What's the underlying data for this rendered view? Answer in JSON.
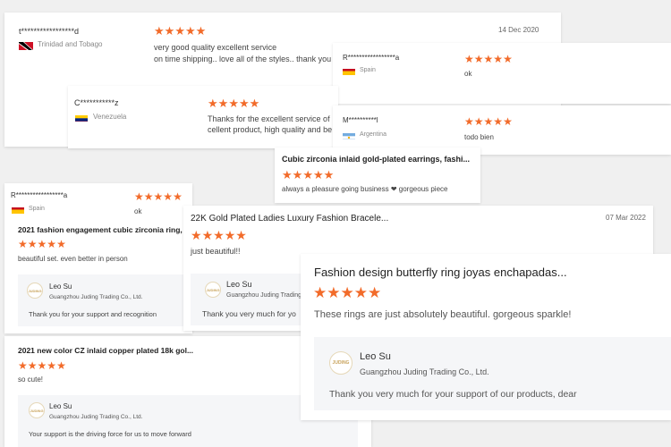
{
  "colors": {
    "star": "#f26b2a",
    "reply_bg": "#f5f6f8"
  },
  "reviews": [
    {
      "name": "t*****************d",
      "country": "Trinidad and Tobago",
      "flag": "trinidad-flag-icon",
      "date": "14 Dec 2020",
      "rating": 5,
      "text_line1": "very good quality excellent service",
      "text_line2": "on time shipping.. love all of the styles.. thank you"
    },
    {
      "name": "R*****************a",
      "country": "Spain",
      "flag": "spain-flag-icon",
      "rating": 5,
      "text": "ok"
    },
    {
      "name": "C***********z",
      "country": "Venezuela",
      "flag": "venezuela-flag-icon",
      "rating": 5,
      "text_line1": "Thanks for the excellent service of",
      "text_line2": "cellent product, high quality and be"
    },
    {
      "name": "M**********l",
      "country": "Argentina",
      "flag": "argentina-flag-icon",
      "rating": 5,
      "text": "todo bien"
    },
    {
      "title": "Cubic zirconia inlaid gold-plated earrings, fashi...",
      "rating": 5,
      "text": "always a pleasure going business ❤ gorgeous piece"
    },
    {
      "name": "R*****************a",
      "country": "Spain",
      "flag": "spain-flag-icon",
      "rating": 5,
      "text": "ok",
      "title": "2021 fashion engagement cubic zirconia ring,",
      "title_rating": 5,
      "title_text": "beautiful set. even better in person",
      "reply": {
        "name": "Leo Su",
        "company": "Guangzhou Juding Trading Co., Ltd.",
        "text": "Thank you for your support and recognition"
      }
    },
    {
      "title": "22K Gold Plated Ladies Luxury Fashion Bracele...",
      "date": "07 Mar 2022",
      "rating": 5,
      "text": "just beautiful!!",
      "reply": {
        "name": "Leo Su",
        "company": "Guangzhou Juding Trading Co., Ltd.",
        "text": "Thank you very much for yo"
      }
    },
    {
      "title": "Fashion design butterfly ring joyas enchapadas...",
      "rating": 5,
      "text": "These rings are just absolutely beautiful. gorgeous sparkle!",
      "reply": {
        "name": "Leo Su",
        "company": "Guangzhou Juding Trading Co., Ltd.",
        "text": "Thank you very much for your support of our products, dear"
      }
    },
    {
      "title": "2021 new color CZ inlaid copper plated 18k gol...",
      "rating": 5,
      "text": "so cute!",
      "reply": {
        "name": "Leo Su",
        "company": "Guangzhou Juding Trading Co., Ltd.",
        "text": "Your support is the driving force for us to move forward"
      }
    }
  ],
  "logo_text": "JUDING"
}
